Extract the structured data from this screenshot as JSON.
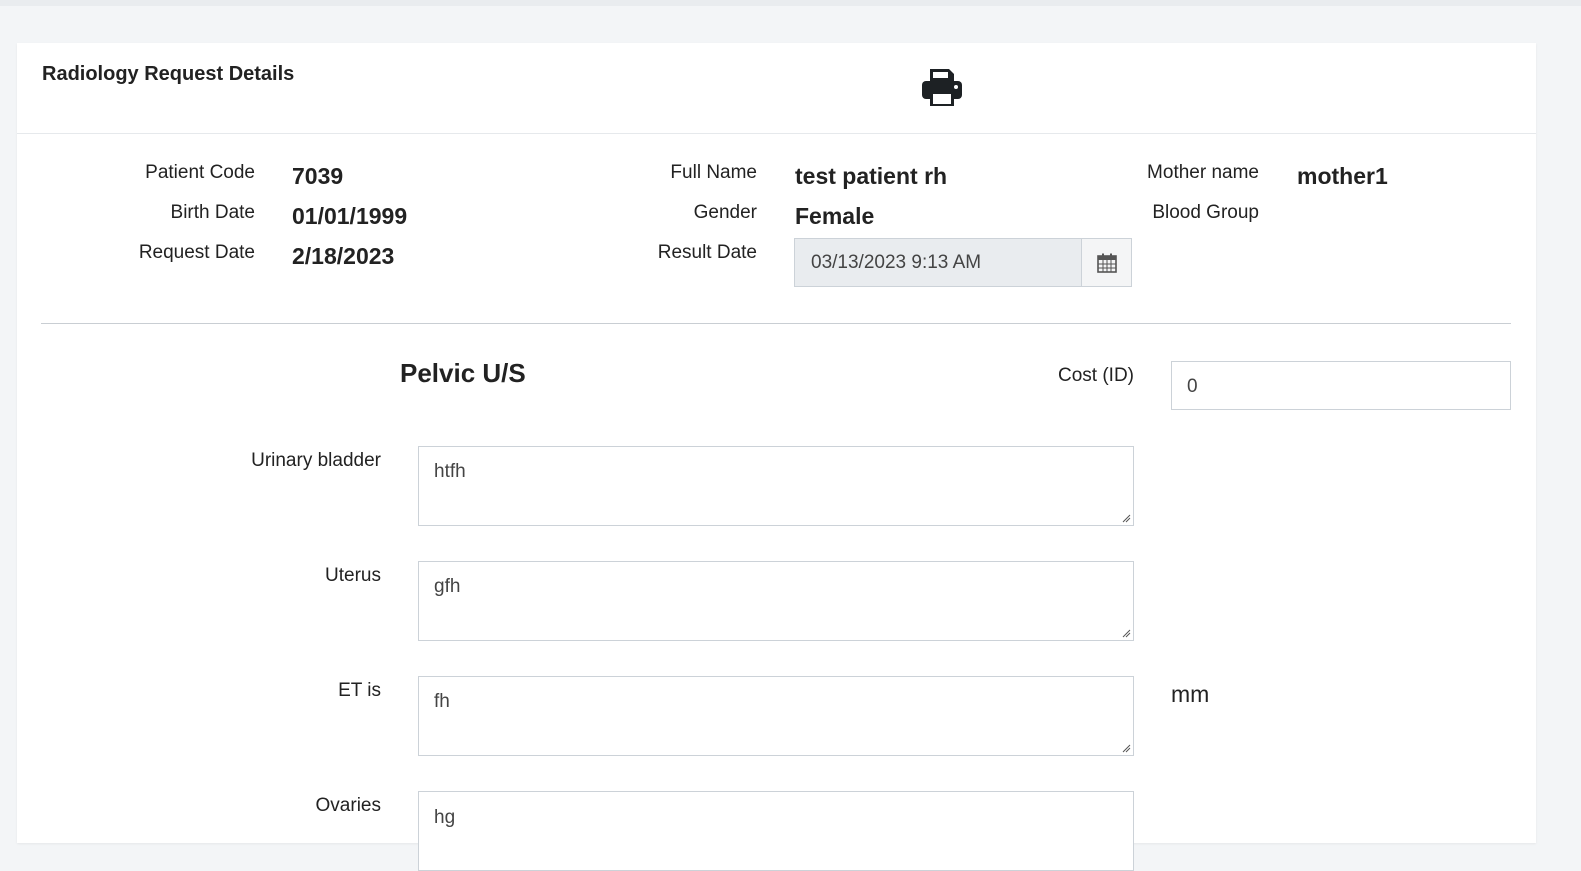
{
  "header": {
    "title": "Radiology Request Details"
  },
  "patient": {
    "code_label": "Patient Code",
    "code": "7039",
    "birth_label": "Birth Date",
    "birth": "01/01/1999",
    "request_label": "Request Date",
    "request": "2/18/2023",
    "name_label": "Full Name",
    "name": "test patient rh",
    "gender_label": "Gender",
    "gender": "Female",
    "result_label": "Result Date",
    "result_value": "03/13/2023 9:13 AM",
    "mother_label": "Mother name",
    "mother": "mother1",
    "blood_label": "Blood Group",
    "blood": ""
  },
  "exam": {
    "title": "Pelvic U/S",
    "cost_label": "Cost (ID)",
    "cost_value": "0",
    "fields": [
      {
        "label": "Urinary bladder",
        "value": "htfh"
      },
      {
        "label": "Uterus",
        "value": "gfh"
      },
      {
        "label": "ET is",
        "value": "fh",
        "unit": "mm"
      },
      {
        "label": "Ovaries",
        "value": "hg"
      }
    ]
  },
  "icons": {
    "print": "print-icon",
    "calendar": "calendar-icon"
  },
  "colors": {
    "background": "#f3f5f7",
    "panel": "#ffffff",
    "readonly_input": "#e9ecef",
    "border": "#ccd2d8"
  }
}
